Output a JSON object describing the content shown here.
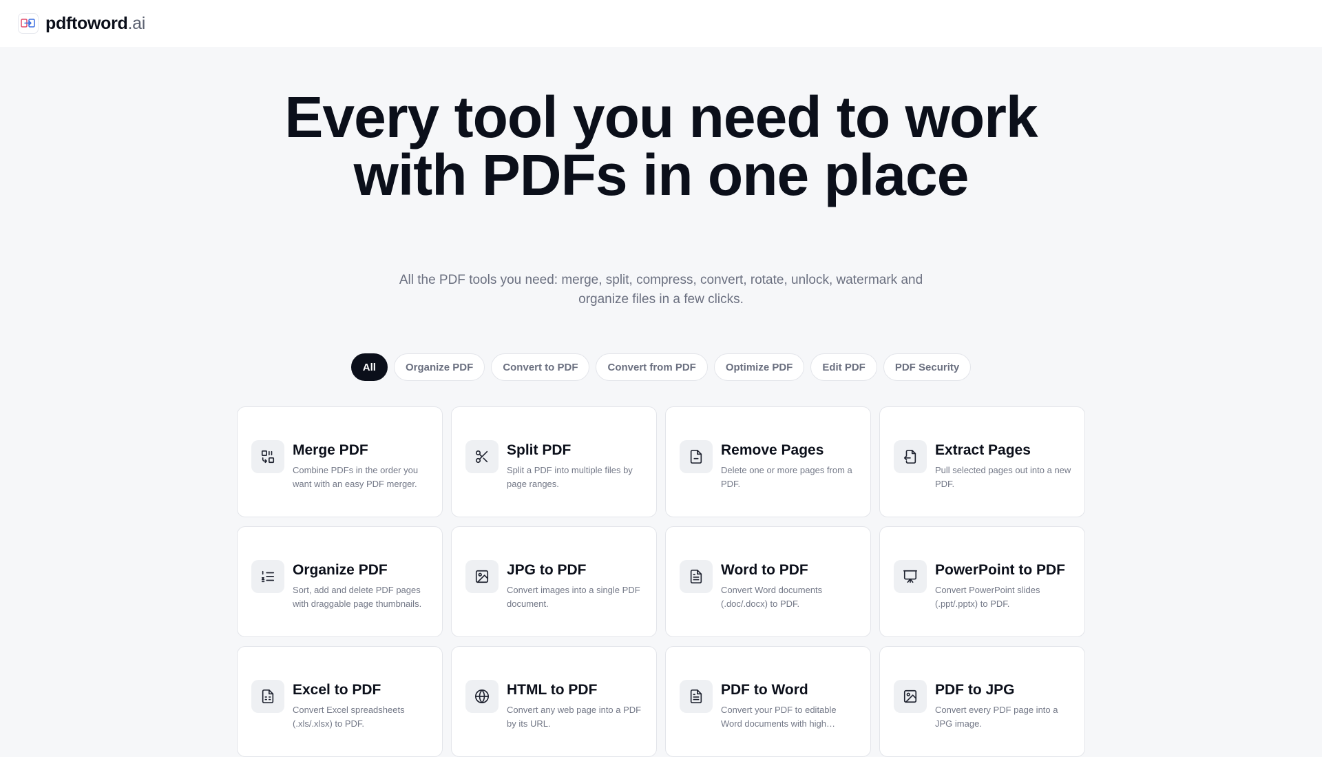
{
  "brand": {
    "name": "pdftoword",
    "tld": ".ai"
  },
  "hero": {
    "title": "Every tool you need to work with PDFs in one place",
    "subtitle": "All the PDF tools you need: merge, split, compress, convert, rotate, unlock, watermark and organize files in a few clicks."
  },
  "tabs": [
    "All",
    "Organize PDF",
    "Convert to PDF",
    "Convert from PDF",
    "Optimize PDF",
    "Edit PDF",
    "PDF Security"
  ],
  "active_tab": "All",
  "tools": [
    {
      "title": "Merge PDF",
      "desc": "Combine PDFs in the order you want with an easy PDF merger.",
      "icon": "merge-icon"
    },
    {
      "title": "Split PDF",
      "desc": "Split a PDF into multiple files by page ranges.",
      "icon": "scissors-icon"
    },
    {
      "title": "Remove Pages",
      "desc": "Delete one or more pages from a PDF.",
      "icon": "file-icon"
    },
    {
      "title": "Extract Pages",
      "desc": "Pull selected pages out into a new PDF.",
      "icon": "file-export-icon"
    },
    {
      "title": "Organize PDF",
      "desc": "Sort, add and delete PDF pages with draggable page thumbnails.",
      "icon": "list-ordered-icon"
    },
    {
      "title": "JPG to PDF",
      "desc": "Convert images into a single PDF document.",
      "icon": "image-icon"
    },
    {
      "title": "Word to PDF",
      "desc": "Convert Word documents (.doc/.docx) to PDF.",
      "icon": "document-icon"
    },
    {
      "title": "PowerPoint to PDF",
      "desc": "Convert PowerPoint slides (.ppt/.pptx) to PDF.",
      "icon": "presentation-icon"
    },
    {
      "title": "Excel to PDF",
      "desc": "Convert Excel spreadsheets (.xls/.xlsx) to PDF.",
      "icon": "spreadsheet-icon"
    },
    {
      "title": "HTML to PDF",
      "desc": "Convert any web page into a PDF by its URL.",
      "icon": "globe-icon"
    },
    {
      "title": "PDF to Word",
      "desc": "Convert your PDF to editable Word documents with high accuracy.",
      "icon": "document-icon"
    },
    {
      "title": "PDF to JPG",
      "desc": "Convert every PDF page into a JPG image.",
      "icon": "image-icon"
    }
  ]
}
